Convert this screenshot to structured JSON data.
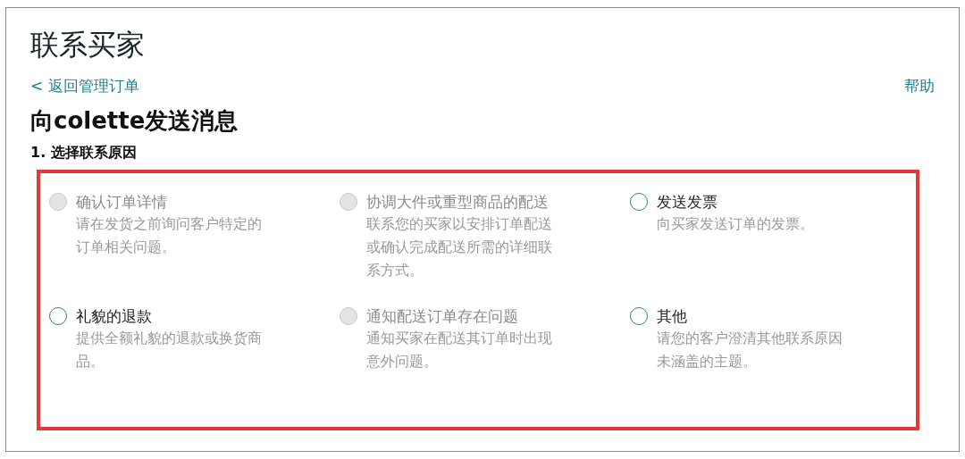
{
  "title": "联系买家",
  "back_link": "< 返回管理订单",
  "help_link": "帮助",
  "heading": "向colette发送消息",
  "step": "1. 选择联系原因",
  "highlighted": true,
  "reasons": [
    {
      "label": "确认订单详情",
      "description": "请在发货之前询问客户特定的订单相关问题。",
      "disabled": true,
      "selected": false
    },
    {
      "label": "协调大件或重型商品的配送",
      "description": "联系您的买家以安排订单配送或确认完成配送所需的详细联系方式。",
      "disabled": true,
      "selected": false
    },
    {
      "label": "发送发票",
      "description": "向买家发送订单的发票。",
      "disabled": false,
      "selected": false
    },
    {
      "label": "礼貌的退款",
      "description": "提供全额礼貌的退款或换货商品。",
      "disabled": false,
      "selected": false
    },
    {
      "label": "通知配送订单存在问题",
      "description": "通知买家在配送其订单时出现意外问题。",
      "disabled": true,
      "selected": false
    },
    {
      "label": "其他",
      "description": "请您的客户澄清其他联系原因未涵盖的主题。",
      "disabled": false,
      "selected": false
    }
  ]
}
